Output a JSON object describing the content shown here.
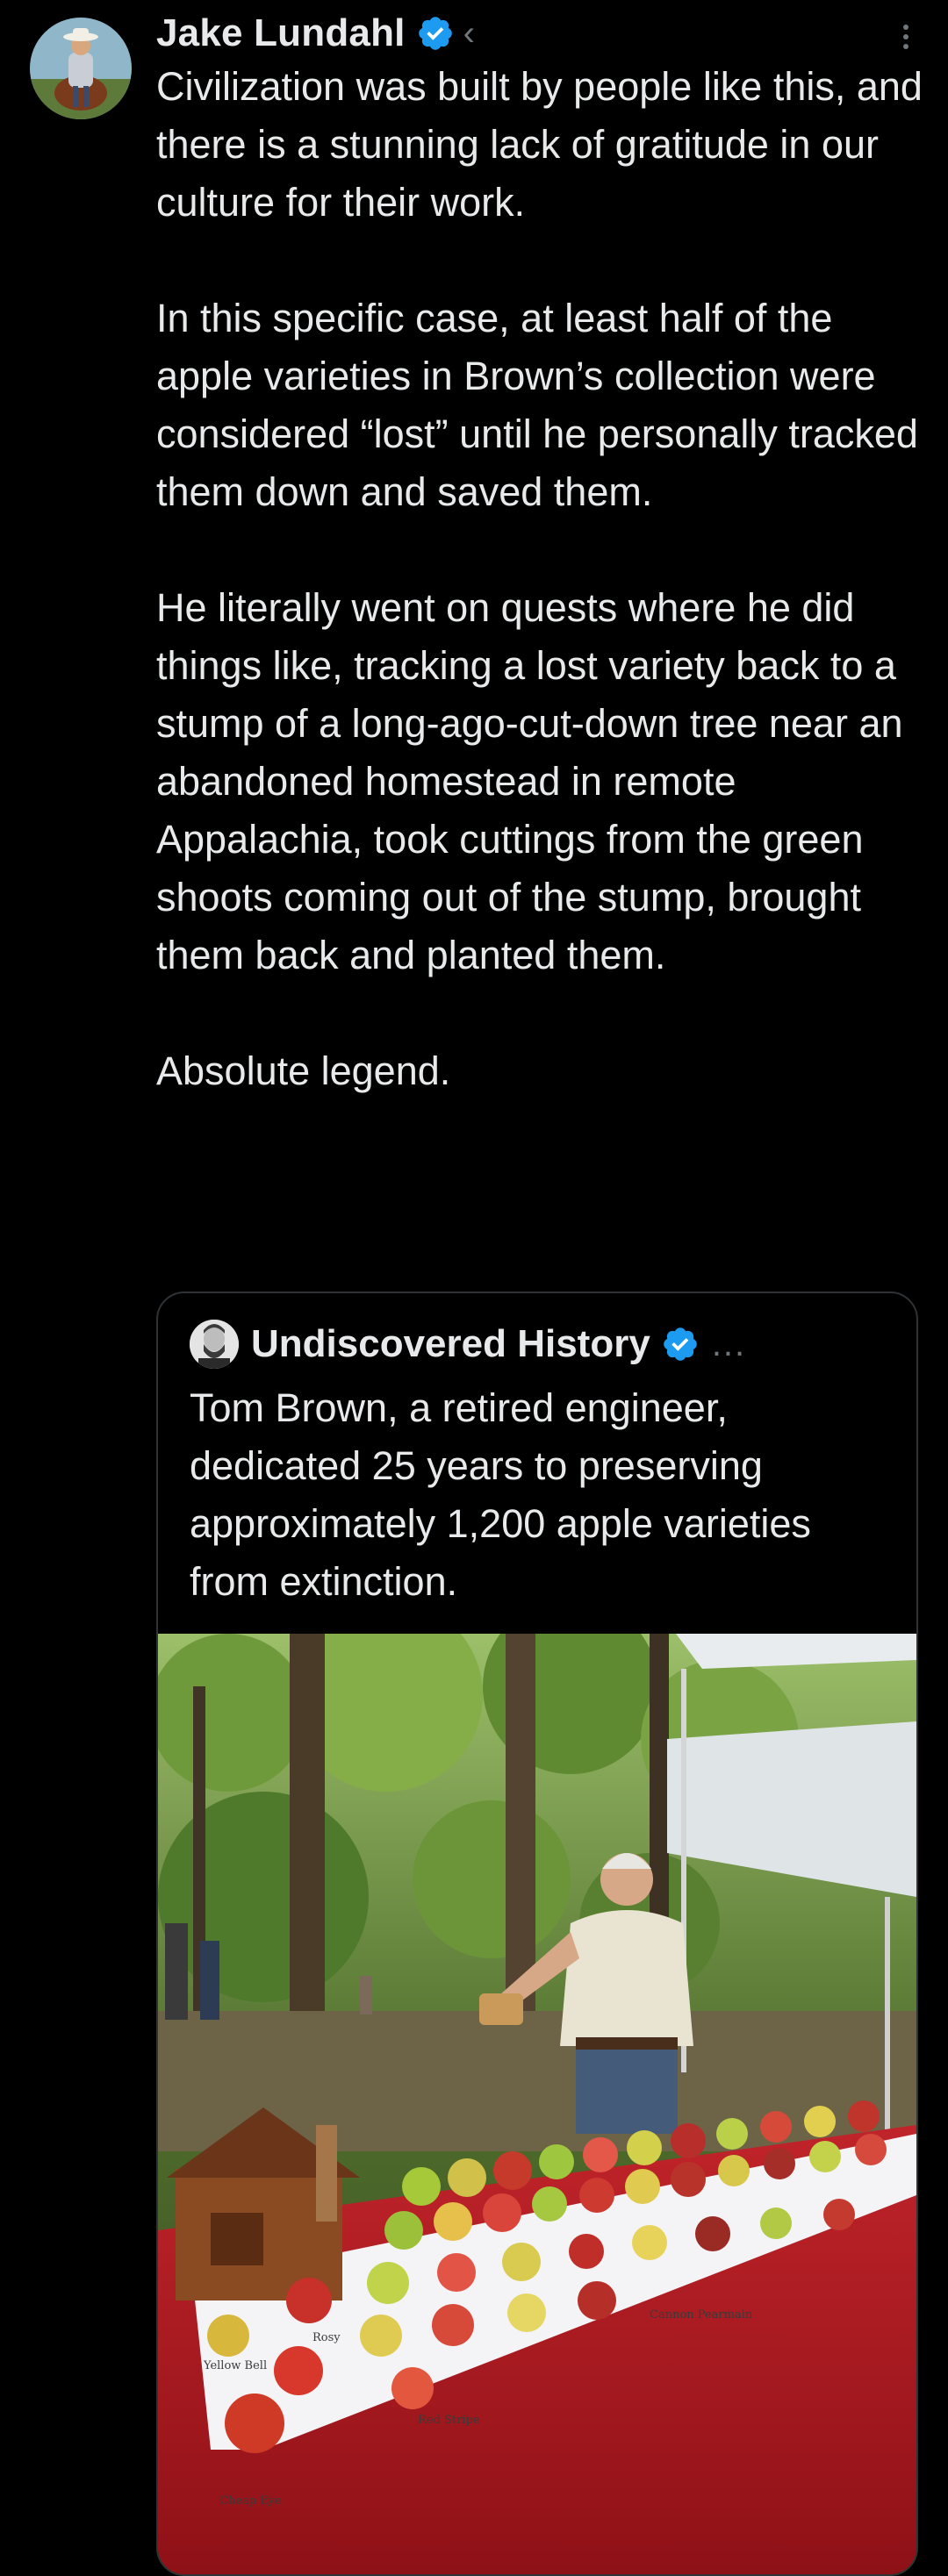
{
  "post": {
    "author": {
      "display_name": "Jake Lundahl",
      "verified": true,
      "handle_fragment": "‹"
    },
    "more_icon": "more-vertical-icon",
    "paragraphs": [
      "Civilization was built by people like this, and there is a stunning lack of gratitude in our culture for their work.",
      "In this specific case, at least half of the apple varieties in Brown’s collection were considered “lost” until he personally tracked them down and saved them.",
      "He literally went on quests where he did things like, tracking a lost variety back to a stump of a long-ago-cut-down tree near an abandoned homestead in remote Appalachia, took cuttings from the green shoots coming out of the stump, brought them back and planted them.",
      "Absolute legend."
    ]
  },
  "quoted_post": {
    "author": {
      "display_name": "Undiscovered History",
      "verified": true,
      "more": "..."
    },
    "text": "Tom Brown, a retired engineer, dedicated 25 years to preserving approximately 1,200 apple varieties from extinction.",
    "media": {
      "label_cards": [
        "Yellow Bell",
        "Rosy",
        "Red Stripe",
        "Cheap Eye",
        "Cannon Pearmain"
      ]
    }
  },
  "colors": {
    "background": "#000000",
    "text": "#e7e9ea",
    "secondary": "#71767b",
    "verified": "#1d9bf0",
    "border": "#2f3336"
  }
}
